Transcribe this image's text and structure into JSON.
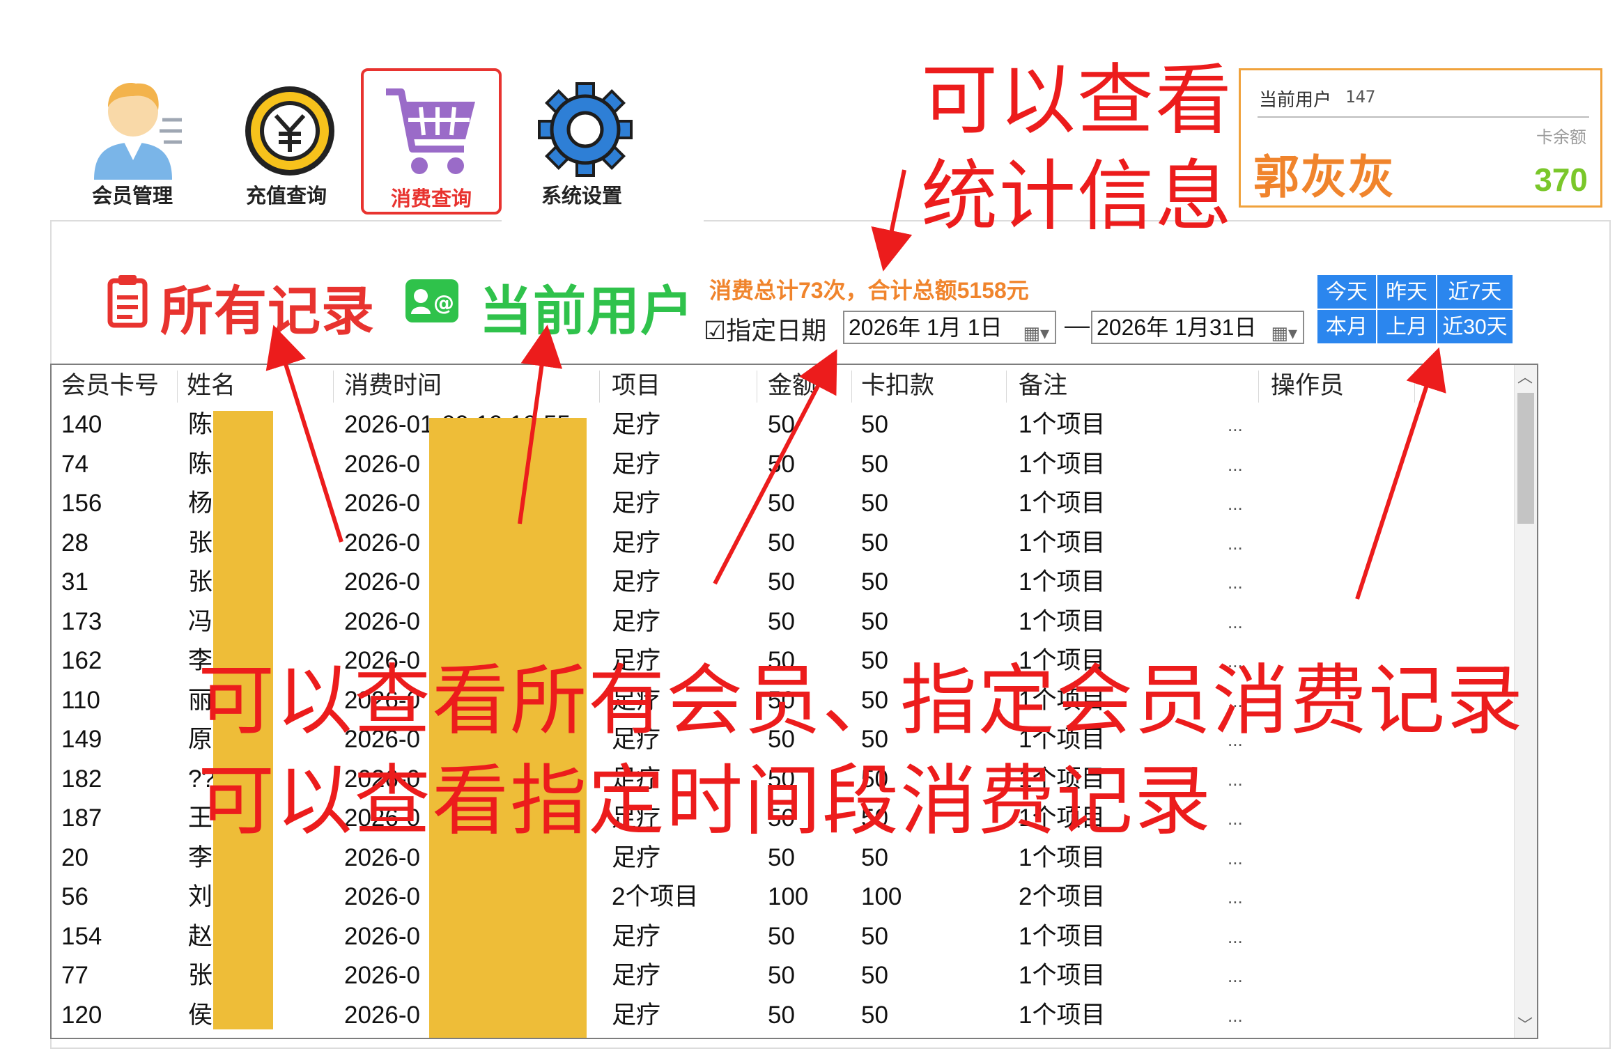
{
  "toolbar": {
    "items": [
      {
        "label": "会员管理",
        "icon": "user-icon"
      },
      {
        "label": "充值查询",
        "icon": "coin-icon"
      },
      {
        "label": "消费查询",
        "icon": "cart-icon",
        "active": true
      },
      {
        "label": "系统设置",
        "icon": "gear-icon"
      }
    ]
  },
  "user_panel": {
    "current_user_label": "当前用户",
    "current_user_id": "147",
    "balance_label": "卡余额",
    "user_name": "郭灰灰",
    "balance": "370"
  },
  "modes": {
    "all_records": "所有记录",
    "current_user": "当前用户"
  },
  "stats": "消费总计73次，合计总额5158元",
  "date_filter": {
    "checkbox_label": "☑指定日期",
    "start": "2026年  1月  1日",
    "end": "2026年  1月31日",
    "separator": "—"
  },
  "quick_ranges": [
    "今天",
    "昨天",
    "近7天",
    "本月",
    "上月",
    "近30天"
  ],
  "table": {
    "columns": [
      "会员卡号",
      "姓名",
      "消费时间",
      "项目",
      "金额",
      "卡扣款",
      "备注",
      "操作员"
    ],
    "rows": [
      {
        "card": "140",
        "name": "陈",
        "time": "2026-01-09 19:10:55",
        "item": "足疗",
        "amount": "50",
        "deduct": "50",
        "note": "1个项目",
        "op": "..."
      },
      {
        "card": "74",
        "name": "陈",
        "time": "2026-0",
        "item": "足疗",
        "amount": "50",
        "deduct": "50",
        "note": "1个项目",
        "op": "..."
      },
      {
        "card": "156",
        "name": "杨",
        "time": "2026-0",
        "item": "足疗",
        "amount": "50",
        "deduct": "50",
        "note": "1个项目",
        "op": "..."
      },
      {
        "card": "28",
        "name": "张",
        "time": "2026-0",
        "item": "足疗",
        "amount": "50",
        "deduct": "50",
        "note": "1个项目",
        "op": "..."
      },
      {
        "card": "31",
        "name": "张",
        "time": "2026-0",
        "item": "足疗",
        "amount": "50",
        "deduct": "50",
        "note": "1个项目",
        "op": "..."
      },
      {
        "card": "173",
        "name": "冯",
        "time": "2026-0",
        "item": "足疗",
        "amount": "50",
        "deduct": "50",
        "note": "1个项目",
        "op": "..."
      },
      {
        "card": "162",
        "name": "李",
        "time": "2026-0",
        "item": "足疗",
        "amount": "50",
        "deduct": "50",
        "note": "1个项目",
        "op": "..."
      },
      {
        "card": "110",
        "name": "丽",
        "time": "2026-0",
        "item": "足疗",
        "amount": "50",
        "deduct": "50",
        "note": "1个项目",
        "op": "..."
      },
      {
        "card": "149",
        "name": "原",
        "time": "2026-0",
        "item": "足疗",
        "amount": "50",
        "deduct": "50",
        "note": "1个项目",
        "op": "..."
      },
      {
        "card": "182",
        "name": "??",
        "time": "2026-0",
        "item": "足疗",
        "amount": "50",
        "deduct": "50",
        "note": "1个项目",
        "op": "..."
      },
      {
        "card": "187",
        "name": "王",
        "time": "2026-0",
        "item": "足疗",
        "amount": "50",
        "deduct": "50",
        "note": "1个项目",
        "op": "..."
      },
      {
        "card": "20",
        "name": "李",
        "time": "2026-0",
        "item": "足疗",
        "amount": "50",
        "deduct": "50",
        "note": "1个项目",
        "op": "..."
      },
      {
        "card": "56",
        "name": "刘",
        "time": "2026-0",
        "item": "2个项目",
        "amount": "100",
        "deduct": "100",
        "note": "2个项目",
        "op": "..."
      },
      {
        "card": "154",
        "name": "赵",
        "time": "2026-0",
        "item": "足疗",
        "amount": "50",
        "deduct": "50",
        "note": "1个项目",
        "op": "..."
      },
      {
        "card": "77",
        "name": "张",
        "time": "2026-0",
        "item": "足疗",
        "amount": "50",
        "deduct": "50",
        "note": "1个项目",
        "op": "..."
      },
      {
        "card": "120",
        "name": "侯",
        "time": "2026-0",
        "item": "足疗",
        "amount": "50",
        "deduct": "50",
        "note": "1个项目",
        "op": "..."
      }
    ]
  },
  "annotations": {
    "stats_note_line1": "可以查看",
    "stats_note_line2": "统计信息",
    "main_note_line1": "可以查看所有会员、指定会员消费记录",
    "main_note_line2": "可以查看指定时间段消费记录"
  },
  "colors": {
    "accent_red": "#e8332f",
    "accent_green": "#2fc24b",
    "accent_orange": "#f0842c",
    "button_blue": "#2b86ee",
    "balance_green": "#7ac72a",
    "mask_yellow": "#eebd38"
  }
}
